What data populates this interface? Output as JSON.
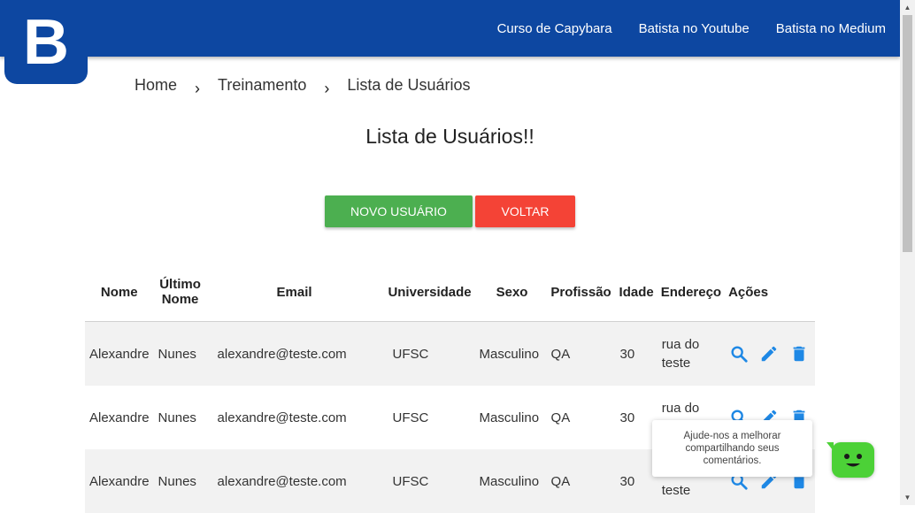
{
  "logo": {
    "letter": "B"
  },
  "nav": {
    "links": [
      "Curso de Capybara",
      "Batista no Youtube",
      "Batista no Medium"
    ]
  },
  "breadcrumb": {
    "items": [
      "Home",
      "Treinamento",
      "Lista de Usuários"
    ],
    "separator": "›"
  },
  "page": {
    "title": "Lista de Usuários!!"
  },
  "buttons": {
    "new_user": "NOVO USUÁRIO",
    "back": "VOLTAR"
  },
  "colors": {
    "navbar": "#0d47a1",
    "new_button": "#4caf50",
    "back_button": "#f44336",
    "action_icon": "#1e88e5",
    "bot": "#4cd137"
  },
  "table": {
    "headers": {
      "nome": "Nome",
      "ultimo_nome": "Último Nome",
      "email": "Email",
      "universidade": "Universidade",
      "sexo": "Sexo",
      "profissao": "Profissão",
      "idade": "Idade",
      "endereco": "Endereço",
      "acoes": "Ações"
    },
    "rows": [
      {
        "nome": "Alexandre",
        "ultimo_nome": "Nunes",
        "email": "alexandre@teste.com",
        "universidade": "UFSC",
        "sexo": "Masculino",
        "profissao": "QA",
        "idade": "30",
        "endereco": "rua do teste"
      },
      {
        "nome": "Alexandre",
        "ultimo_nome": "Nunes",
        "email": "alexandre@teste.com",
        "universidade": "UFSC",
        "sexo": "Masculino",
        "profissao": "QA",
        "idade": "30",
        "endereco": "rua do teste"
      },
      {
        "nome": "Alexandre",
        "ultimo_nome": "Nunes",
        "email": "alexandre@teste.com",
        "universidade": "UFSC",
        "sexo": "Masculino",
        "profissao": "QA",
        "idade": "30",
        "endereco": "rua do teste"
      }
    ],
    "action_icons": [
      "search-icon",
      "edit-icon",
      "delete-icon"
    ]
  },
  "feedback": {
    "text": "Ajude-nos a melhorar compartilhando seus comentários."
  }
}
